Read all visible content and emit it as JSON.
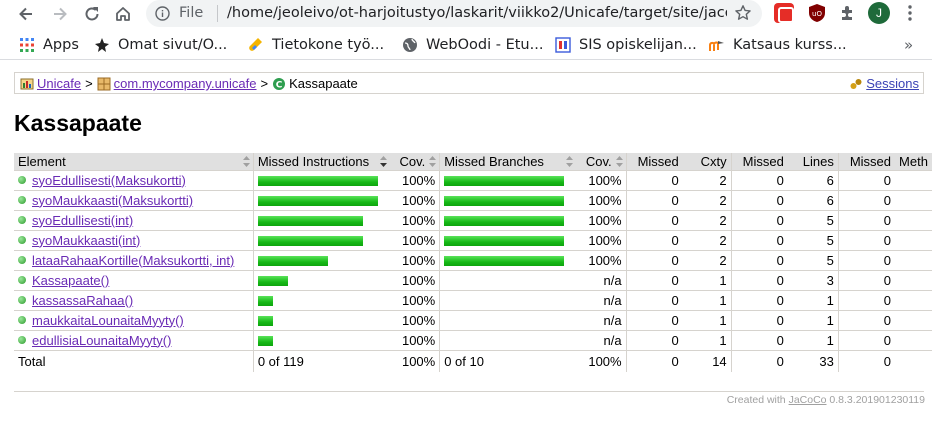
{
  "browser": {
    "omnibox_scheme": "File",
    "url": "/home/jeoleivo/ot-harjoitustyo/laskarit/viikko2/Unicafe/target/site/jacoco/c...",
    "avatar_letter": "J",
    "bookmarks": [
      {
        "label": "Apps",
        "icon": "apps-grid-icon"
      },
      {
        "label": "Omat sivut/O...",
        "icon": "star-creature-icon"
      },
      {
        "label": "Tietokone työ...",
        "icon": "test-tube-icon"
      },
      {
        "label": "WebOodi - Etu...",
        "icon": "globe-icon"
      },
      {
        "label": "SIS opiskelijan...",
        "icon": "sis-icon"
      },
      {
        "label": "Katsaus kurss...",
        "icon": "moodle-icon"
      }
    ]
  },
  "breadcrumb": {
    "project": "Unicafe",
    "package": "com.mycompany.unicafe",
    "current": "Kassapaate",
    "separator": ">",
    "sessions": "Sessions"
  },
  "page_title": "Kassapaate",
  "table": {
    "headers": {
      "element": "Element",
      "missed_instructions": "Missed Instructions",
      "cov1": "Cov.",
      "missed_branches": "Missed Branches",
      "cov2": "Cov.",
      "missed_cxty": "Missed",
      "cxty": "Cxty",
      "missed_lines": "Missed",
      "lines": "Lines",
      "missed_methods": "Missed",
      "methods": "Meth"
    },
    "rows": [
      {
        "name": "syoEdullisesti(Maksukortti)",
        "instr_fraction": 1.0,
        "cov1": "100%",
        "branch_fraction": 1.0,
        "cov2": "100%",
        "missed_cxty": "0",
        "cxty": "2",
        "missed_lines": "0",
        "lines": "6",
        "missed_methods": "0"
      },
      {
        "name": "syoMaukkaasti(Maksukortti)",
        "instr_fraction": 1.0,
        "cov1": "100%",
        "branch_fraction": 1.0,
        "cov2": "100%",
        "missed_cxty": "0",
        "cxty": "2",
        "missed_lines": "0",
        "lines": "6",
        "missed_methods": "0"
      },
      {
        "name": "syoEdullisesti(int)",
        "instr_fraction": 0.875,
        "cov1": "100%",
        "branch_fraction": 1.0,
        "cov2": "100%",
        "missed_cxty": "0",
        "cxty": "2",
        "missed_lines": "0",
        "lines": "5",
        "missed_methods": "0"
      },
      {
        "name": "syoMaukkaasti(int)",
        "instr_fraction": 0.875,
        "cov1": "100%",
        "branch_fraction": 1.0,
        "cov2": "100%",
        "missed_cxty": "0",
        "cxty": "2",
        "missed_lines": "0",
        "lines": "5",
        "missed_methods": "0"
      },
      {
        "name": "lataaRahaaKortille(Maksukortti, int)",
        "instr_fraction": 0.583,
        "cov1": "100%",
        "branch_fraction": 1.0,
        "cov2": "100%",
        "missed_cxty": "0",
        "cxty": "2",
        "missed_lines": "0",
        "lines": "5",
        "missed_methods": "0"
      },
      {
        "name": "Kassapaate()",
        "instr_fraction": 0.25,
        "cov1": "100%",
        "branch_fraction": 0,
        "cov2": "n/a",
        "missed_cxty": "0",
        "cxty": "1",
        "missed_lines": "0",
        "lines": "3",
        "missed_methods": "0"
      },
      {
        "name": "kassassaRahaa()",
        "instr_fraction": 0.125,
        "cov1": "100%",
        "branch_fraction": 0,
        "cov2": "n/a",
        "missed_cxty": "0",
        "cxty": "1",
        "missed_lines": "0",
        "lines": "1",
        "missed_methods": "0"
      },
      {
        "name": "maukkaitaLounaitaMyyty()",
        "instr_fraction": 0.125,
        "cov1": "100%",
        "branch_fraction": 0,
        "cov2": "n/a",
        "missed_cxty": "0",
        "cxty": "1",
        "missed_lines": "0",
        "lines": "1",
        "missed_methods": "0"
      },
      {
        "name": "edullisiaLounaitaMyyty()",
        "instr_fraction": 0.125,
        "cov1": "100%",
        "branch_fraction": 0,
        "cov2": "n/a",
        "missed_cxty": "0",
        "cxty": "1",
        "missed_lines": "0",
        "lines": "1",
        "missed_methods": "0"
      }
    ],
    "total": {
      "label": "Total",
      "missed_instructions": "0 of 119",
      "cov1": "100%",
      "missed_branches": "0 of 10",
      "cov2": "100%",
      "missed_cxty": "0",
      "cxty": "14",
      "missed_lines": "0",
      "lines": "33",
      "missed_methods": "0"
    }
  },
  "footer": {
    "prefix": "Created with",
    "link": "JaCoCo",
    "version": "0.8.3.201901230119"
  },
  "colors": {
    "bar_green": "#16b916",
    "link_visited": "#6a2bb5",
    "header_bg": "#e0e0e0"
  }
}
